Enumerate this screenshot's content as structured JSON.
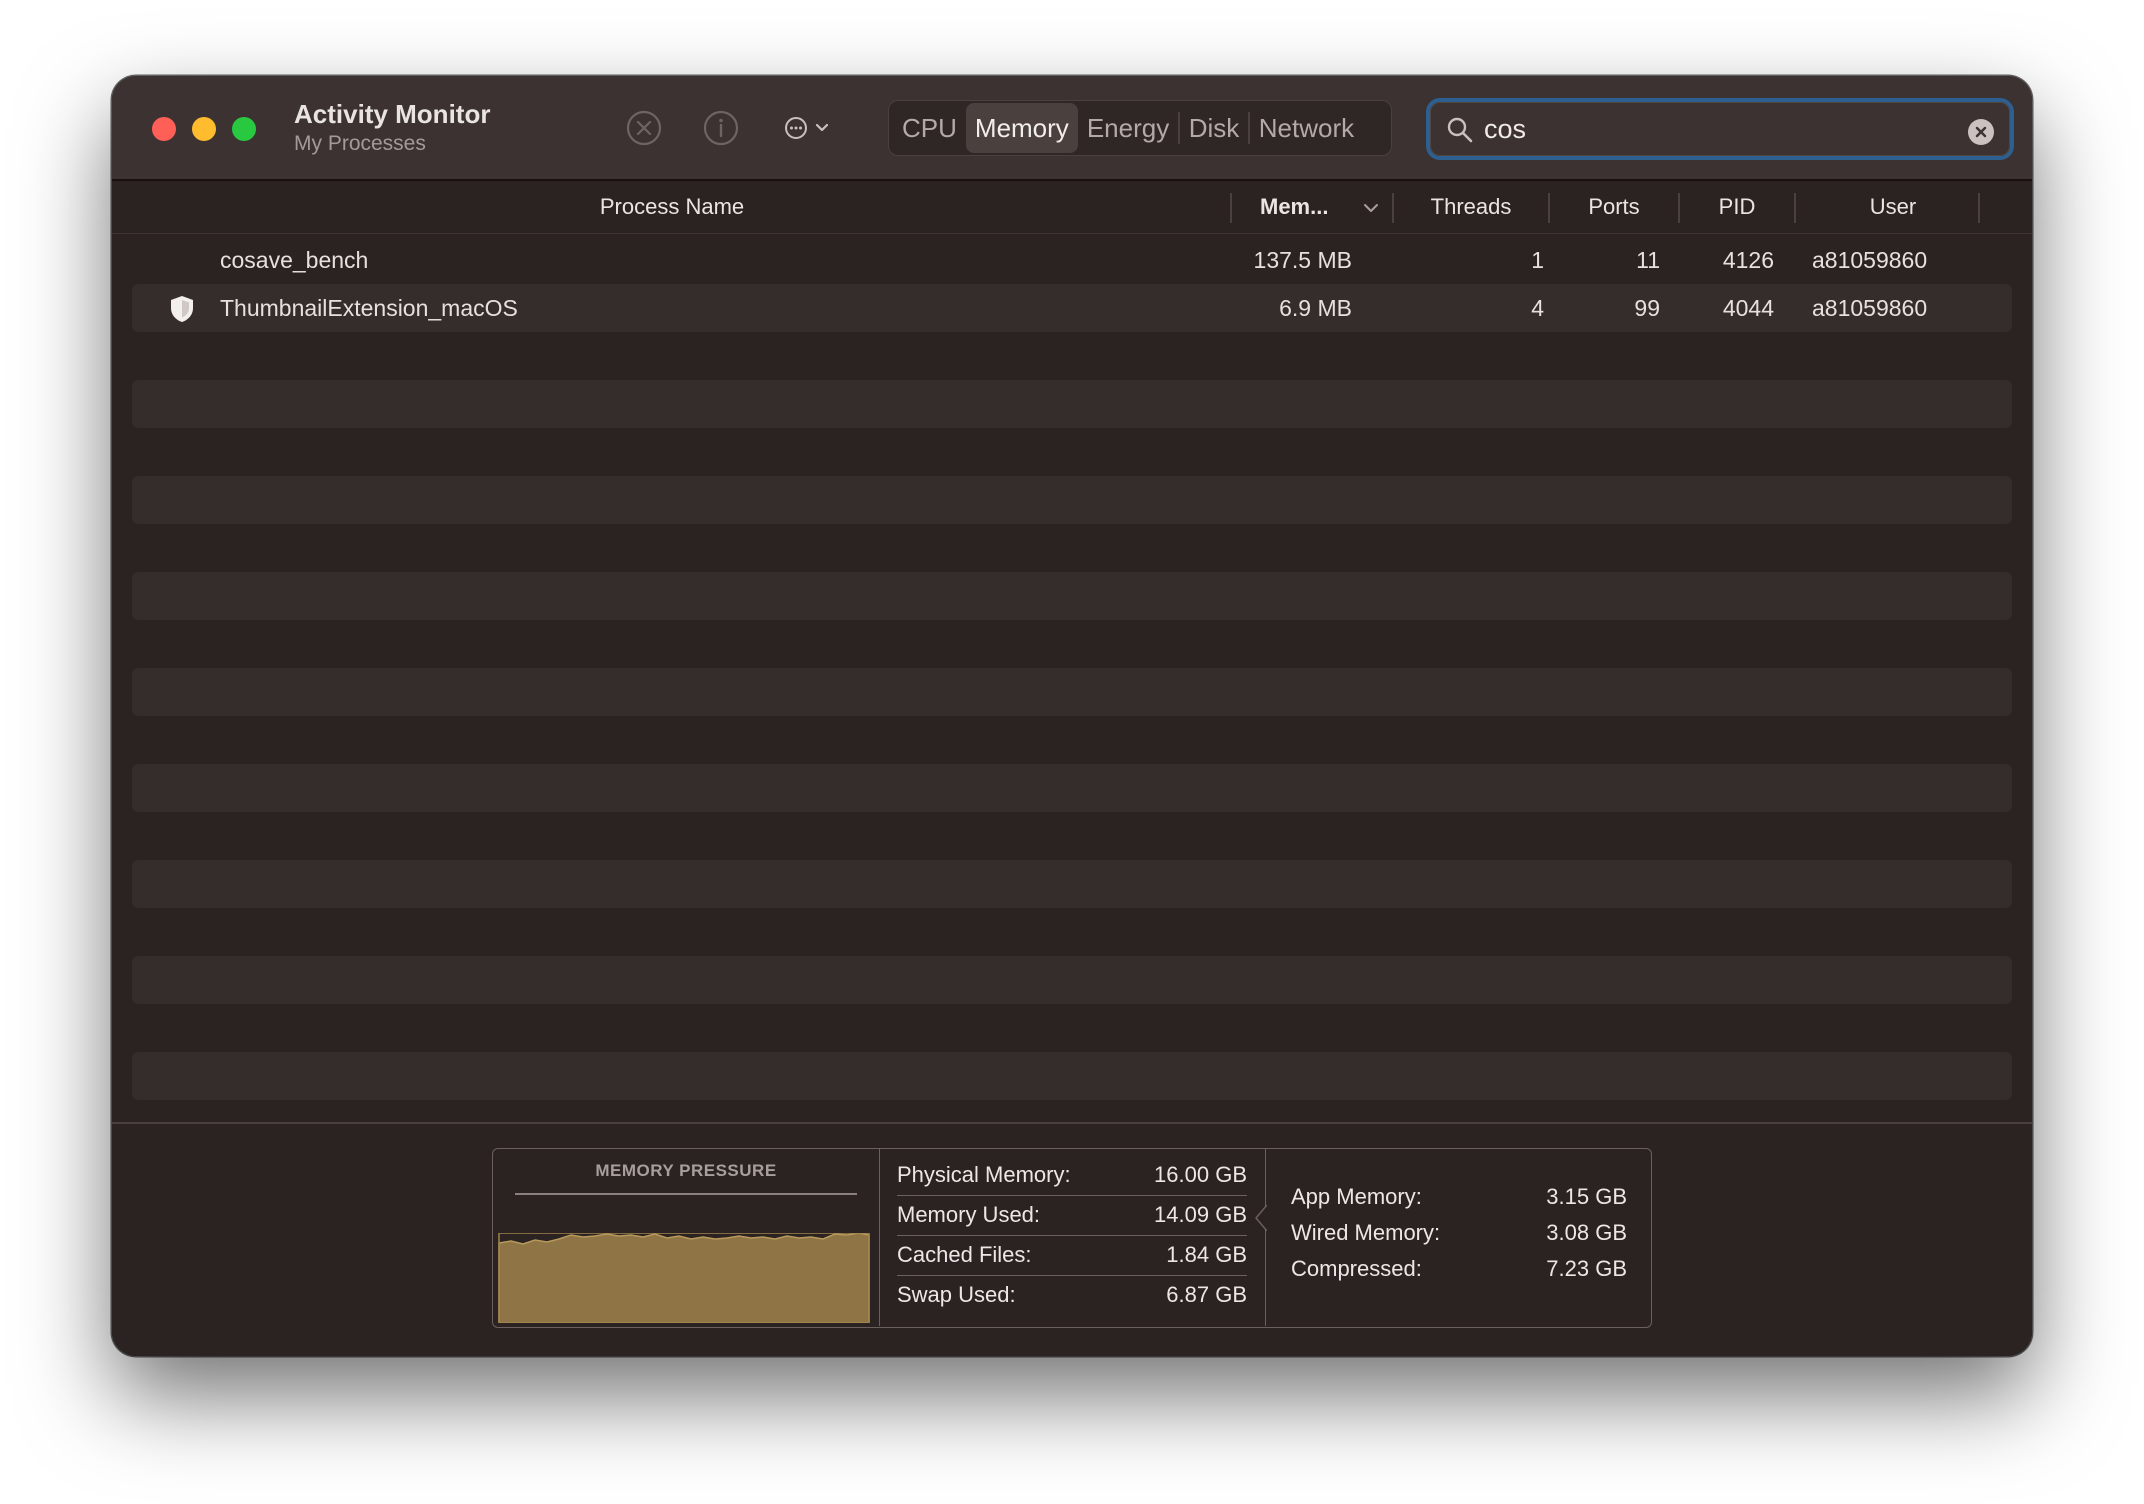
{
  "window": {
    "title": "Activity Monitor",
    "subtitle": "My Processes"
  },
  "toolbar": {
    "stop_icon": "x-circle-icon",
    "info_icon": "info-icon",
    "more_icon": "ellipsis-circle-icon"
  },
  "tabs": [
    {
      "label": "CPU",
      "active": false
    },
    {
      "label": "Memory",
      "active": true
    },
    {
      "label": "Energy",
      "active": false
    },
    {
      "label": "Disk",
      "active": false
    },
    {
      "label": "Network",
      "active": false
    }
  ],
  "search": {
    "value": "cos",
    "focus_color": "#2e5f91"
  },
  "table": {
    "columns": [
      "Process Name",
      "Mem...",
      "Threads",
      "Ports",
      "PID",
      "User"
    ],
    "sorted_column": "Mem...",
    "rows": [
      {
        "name": "cosave_bench",
        "icon": "",
        "memory": "137.5 MB",
        "threads": "1",
        "ports": "11",
        "pid": "4126",
        "user": "a81059860"
      },
      {
        "name": "ThumbnailExtension_macOS",
        "icon": "shield-icon",
        "memory": "6.9 MB",
        "threads": "4",
        "ports": "99",
        "pid": "4044",
        "user": "a81059860"
      }
    ]
  },
  "footer": {
    "pressure_title": "MEMORY PRESSURE",
    "pressure_color": "#8f7445",
    "physical_memory_label": "Physical Memory:",
    "physical_memory_value": "16.00 GB",
    "memory_used_label": "Memory Used:",
    "memory_used_value": "14.09 GB",
    "cached_files_label": "Cached Files:",
    "cached_files_value": "1.84 GB",
    "swap_used_label": "Swap Used:",
    "swap_used_value": "6.87 GB",
    "app_memory_label": "App Memory:",
    "app_memory_value": "3.15 GB",
    "wired_memory_label": "Wired Memory:",
    "wired_memory_value": "3.08 GB",
    "compressed_label": "Compressed:",
    "compressed_value": "7.23 GB"
  }
}
